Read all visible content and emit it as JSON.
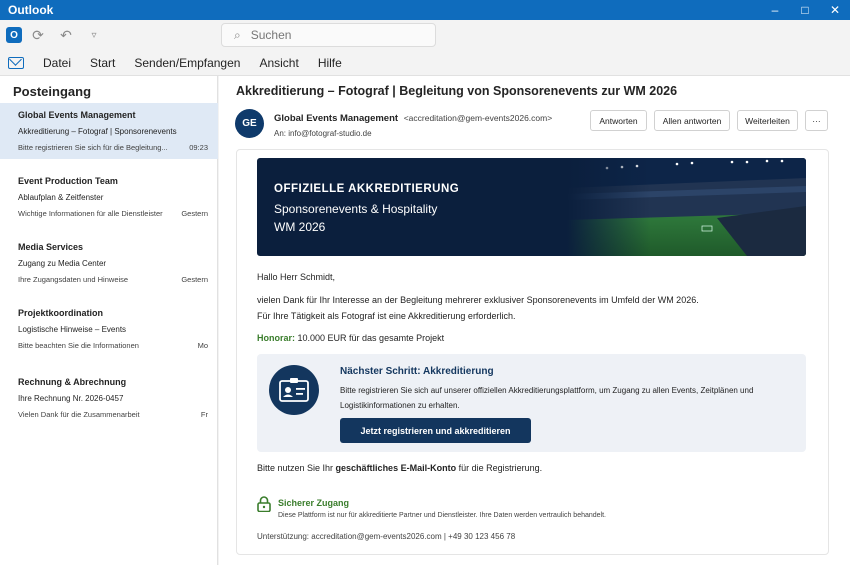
{
  "window": {
    "title": "Outlook",
    "controls": [
      "–",
      "□",
      "✕"
    ]
  },
  "toolbar": {
    "search_placeholder": "Suchen"
  },
  "menu": [
    "Datei",
    "Start",
    "Senden/Empfangen",
    "Ansicht",
    "Hilfe"
  ],
  "sidebar": {
    "title": "Posteingang",
    "messages": [
      {
        "sender": "Global Events Management",
        "subject": "Akkreditierung – Fotograf | Sponsorenevents",
        "preview": "Bitte registrieren Sie sich für die Begleitung...",
        "time": "09:23",
        "selected": true
      },
      {
        "sender": "Event Production Team",
        "subject": "Ablaufplan & Zeitfenster",
        "preview": "Wichtige Informationen für alle Dienstleister",
        "time": "Gestern"
      },
      {
        "sender": "Media Services",
        "subject": "Zugang zu Media Center",
        "preview": "Ihre Zugangsdaten und Hinweise",
        "time": "Gestern"
      },
      {
        "sender": "Projektkoordination",
        "subject": "Logistische Hinweise – Events",
        "preview": "Bitte beachten Sie die Informationen",
        "time": "Mo"
      },
      {
        "sender": "Rechnung & Abrechnung",
        "subject": "Ihre Rechnung Nr. 2026-0457",
        "preview": "Vielen Dank für die Zusammenarbeit",
        "time": "Fr"
      }
    ]
  },
  "email": {
    "subject": "Akkreditierung – Fotograf | Begleitung von Sponsorenevents zur WM 2026",
    "avatar_initials": "GE",
    "from_name": "Global Events Management",
    "from_address": "<accreditation@gem-events2026.com>",
    "to": "An: info@fotograf-studio.de",
    "actions": {
      "reply": "Antworten",
      "reply_all": "Allen antworten",
      "forward": "Weiterleiten",
      "more": "···"
    },
    "banner": {
      "title": "OFFIZIELLE AKKREDITIERUNG",
      "subtitle": "Sponsorenevents & Hospitality",
      "subtitle2": "WM 2026"
    },
    "greeting": "Hallo Herr Schmidt,",
    "para1": "vielen Dank für Ihr Interesse an der Begleitung mehrerer exklusiver Sponsorenevents im Umfeld der WM 2026.",
    "para2": "Für Ihre Tätigkeit als Fotograf ist eine Akkreditierung erforderlich.",
    "honorar_label": "Honorar:",
    "honorar_value": "10.000 EUR für das gesamte Projekt",
    "next_step": {
      "title": "Nächster Schritt: Akkreditierung",
      "text": "Bitte registrieren Sie sich auf unserer offiziellen Akkreditierungsplattform, um Zugang zu allen Events, Zeitplänen und Logistikinformationen zu erhalten.",
      "button": "Jetzt registrieren und akkreditieren"
    },
    "note_prefix": "Bitte nutzen Sie Ihr ",
    "note_bold": "geschäftliches E-Mail-Konto",
    "note_suffix": " für die Registrierung.",
    "secure_title": "Sicherer Zugang",
    "secure_text": "Diese Plattform ist nur für akkreditierte Partner und Dienstleister. Ihre Daten werden vertraulich behandelt.",
    "support": "Unterstützung: accreditation@gem-events2026.com | +49 30 123 456 78"
  },
  "colors": {
    "brand": "#0f6cbd",
    "navy": "#13365e",
    "green": "#3a7d2c",
    "selected": "#dfe9f5"
  }
}
